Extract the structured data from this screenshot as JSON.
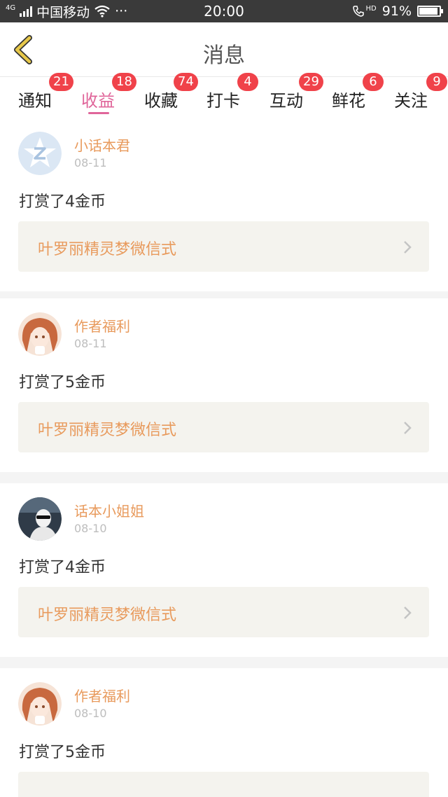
{
  "status_bar": {
    "network": "4G",
    "carrier": "中国移动",
    "dots": "···",
    "time": "20:00",
    "hd": "HD",
    "battery": "91%"
  },
  "header": {
    "title": "消息"
  },
  "tabs": [
    {
      "label": "通知",
      "badge": "21"
    },
    {
      "label": "收益",
      "badge": "18"
    },
    {
      "label": "收藏",
      "badge": "74"
    },
    {
      "label": "打卡",
      "badge": "4"
    },
    {
      "label": "互动",
      "badge": "29"
    },
    {
      "label": "鲜花",
      "badge": "6"
    },
    {
      "label": "关注",
      "badge": "9"
    }
  ],
  "active_tab": "收益",
  "messages": [
    {
      "name": "小话本君",
      "date": "08-11",
      "text": "打赏了4金币",
      "book": "叶罗丽精灵梦微信式",
      "avatar": "logo-avatar"
    },
    {
      "name": "作者福利",
      "date": "08-11",
      "text": "打赏了5金币",
      "book": "叶罗丽精灵梦微信式",
      "avatar": "anime-girl-avatar"
    },
    {
      "name": "话本小姐姐",
      "date": "08-10",
      "text": "打赏了4金币",
      "book": "叶罗丽精灵梦微信式",
      "avatar": "photo-avatar"
    },
    {
      "name": "作者福利",
      "date": "08-10",
      "text": "打赏了5金币",
      "book": "",
      "avatar": "anime-girl-avatar"
    }
  ],
  "colors": {
    "accent": "#e0659a",
    "badge": "#f0424a",
    "name": "#e89a5c",
    "back_arrow": "#e7c84a"
  }
}
